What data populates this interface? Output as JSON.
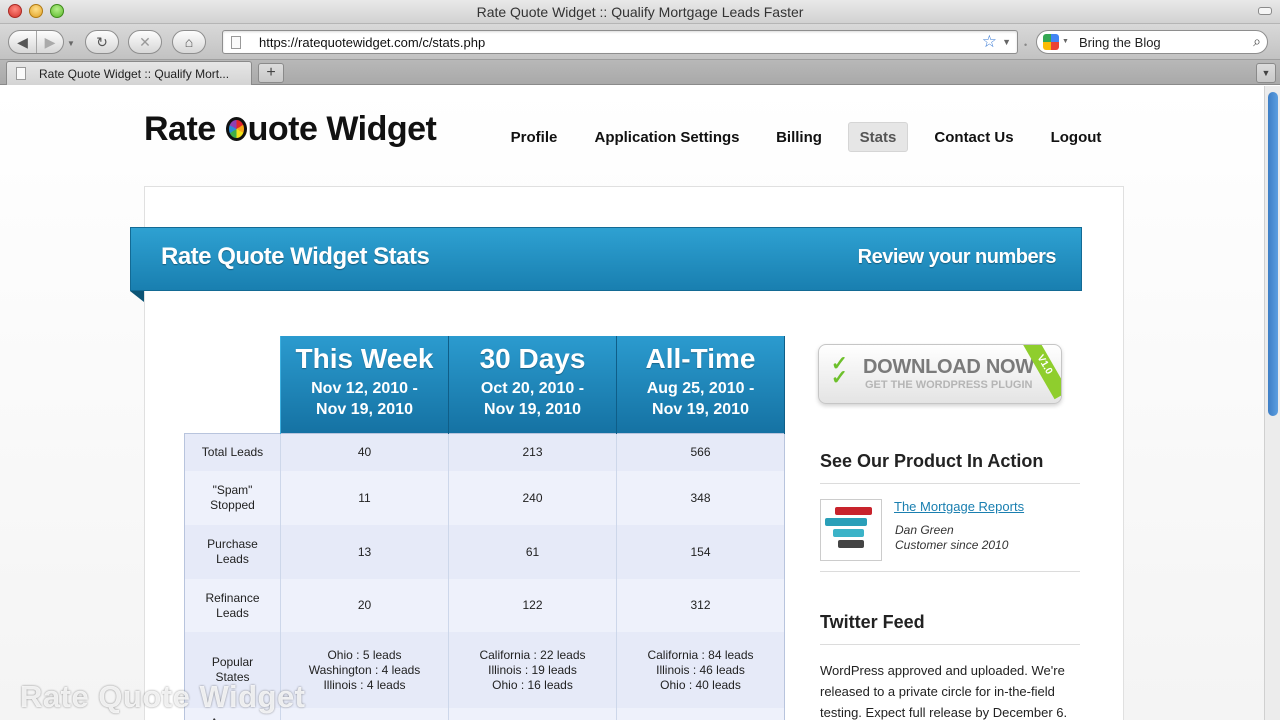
{
  "window": {
    "title": "Rate Quote Widget :: Qualify Mortgage Leads Faster"
  },
  "toolbar": {
    "url": "https://ratequotewidget.com/c/stats.php",
    "search_value": "Bring the Blog",
    "back_icon": "◀",
    "forward_icon": "▶",
    "reload_icon": "↻",
    "stop_icon": "✕",
    "home_icon": "⌂",
    "star_icon": "☆",
    "search_icon": "⌕"
  },
  "tabs": [
    {
      "title": "Rate Quote Widget :: Qualify Mort..."
    }
  ],
  "site": {
    "logo_before": "Rate ",
    "logo_after": "uote Widget",
    "nav": [
      {
        "label": "Profile"
      },
      {
        "label": "Application Settings"
      },
      {
        "label": "Billing"
      },
      {
        "label": "Stats",
        "active": true
      },
      {
        "label": "Contact Us"
      },
      {
        "label": "Logout"
      }
    ]
  },
  "banner": {
    "title": "Rate Quote Widget Stats",
    "subtitle": "Review your numbers"
  },
  "stats": {
    "periods": [
      {
        "name": "This Week",
        "range_start": "Nov 12, 2010 -",
        "range_end": "Nov 19, 2010"
      },
      {
        "name": "30 Days",
        "range_start": "Oct 20, 2010 -",
        "range_end": "Nov 19, 2010"
      },
      {
        "name": "All-Time",
        "range_start": "Aug 25, 2010 -",
        "range_end": "Nov 19, 2010"
      }
    ],
    "rows": [
      {
        "label": [
          "Total Leads"
        ],
        "values": [
          [
            "40"
          ],
          [
            "213"
          ],
          [
            "566"
          ]
        ]
      },
      {
        "label": [
          "\"Spam\"",
          "Stopped"
        ],
        "values": [
          [
            "11"
          ],
          [
            "240"
          ],
          [
            "348"
          ]
        ]
      },
      {
        "label": [
          "Purchase",
          "Leads"
        ],
        "values": [
          [
            "13"
          ],
          [
            "61"
          ],
          [
            "154"
          ]
        ]
      },
      {
        "label": [
          "Refinance",
          "Leads"
        ],
        "values": [
          [
            "20"
          ],
          [
            "122"
          ],
          [
            "312"
          ]
        ]
      },
      {
        "label": [
          "Popular",
          "States"
        ],
        "values": [
          [
            "Ohio : 5 leads",
            "Washington : 4 leads",
            "Illinois : 4 leads"
          ],
          [
            "California : 22 leads",
            "Illinois : 19 leads",
            "Ohio : 16 leads"
          ],
          [
            "California : 84 leads",
            "Illinois : 46 leads",
            "Ohio : 40 leads"
          ]
        ]
      },
      {
        "label": [
          "Average"
        ],
        "values": [
          [
            ""
          ],
          [
            ""
          ],
          [
            ""
          ]
        ]
      }
    ]
  },
  "sidebar": {
    "download": {
      "title": "DOWNLOAD NOW",
      "subtitle": "GET THE WORDPRESS PLUGIN",
      "badge": "V1.0"
    },
    "product_heading": "See Our Product In Action",
    "testimonial": {
      "link": "The Mortgage Reports",
      "name": "Dan Green",
      "since": "Customer since 2010"
    },
    "twitter_heading": "Twitter Feed",
    "tweet": "WordPress approved and uploaded. We're released to a private circle for in-the-field testing. Expect full release by December 6."
  },
  "watermark": "Rate Quote Widget",
  "colors": {
    "banner": "#2ea1d2",
    "table_header": "#1f87bb",
    "link": "#1a7fb0",
    "plugin_accent": "#8fce2d"
  }
}
